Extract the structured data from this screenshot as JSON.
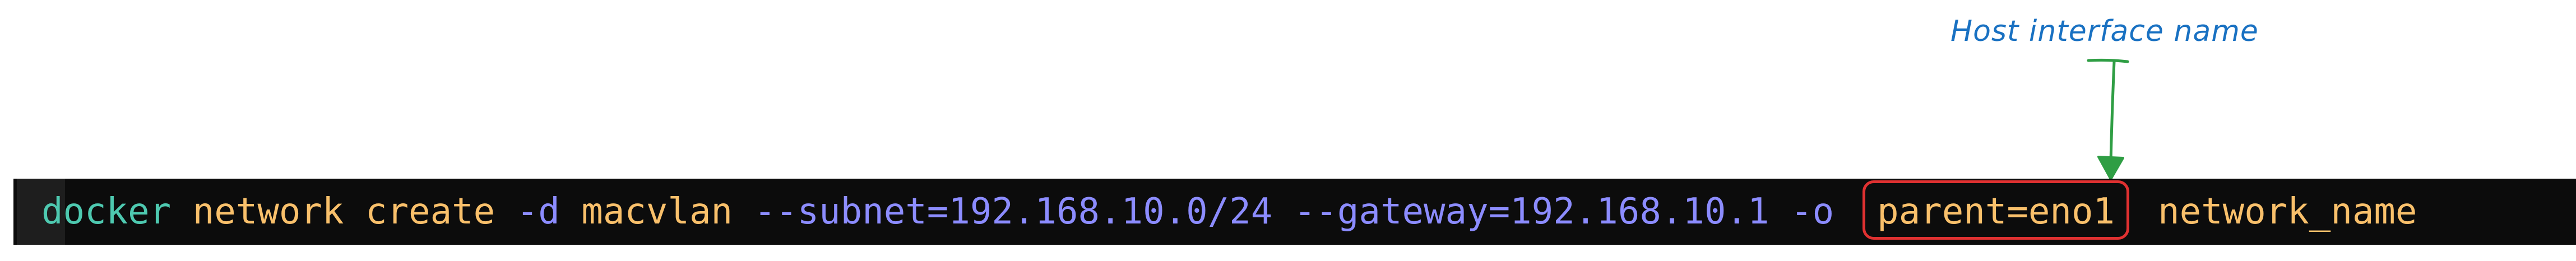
{
  "annotation": {
    "label": "Host interface name",
    "color": "#1971c2",
    "arrow_color": "#2f9e44"
  },
  "command": {
    "tokens": [
      {
        "text": "docker",
        "color": "#4ec9b0"
      },
      {
        "text": " ",
        "color": "#cccccc"
      },
      {
        "text": "network",
        "color": "#f9c06b"
      },
      {
        "text": " ",
        "color": "#cccccc"
      },
      {
        "text": "create",
        "color": "#f9c06b"
      },
      {
        "text": " ",
        "color": "#cccccc"
      },
      {
        "text": "-d",
        "color": "#8c8cff"
      },
      {
        "text": " ",
        "color": "#cccccc"
      },
      {
        "text": "macvlan",
        "color": "#f9c06b"
      },
      {
        "text": " ",
        "color": "#cccccc"
      },
      {
        "text": "--subnet=192.168.10.0/24",
        "color": "#8c8cff"
      },
      {
        "text": " ",
        "color": "#cccccc"
      },
      {
        "text": "--gateway=192.168.10.1",
        "color": "#8c8cff"
      },
      {
        "text": " ",
        "color": "#cccccc"
      },
      {
        "text": "-o",
        "color": "#8c8cff"
      },
      {
        "text": "  ",
        "color": "#cccccc"
      },
      {
        "text": "parent=eno1",
        "color": "#f9c06b"
      },
      {
        "text": "  ",
        "color": "#cccccc"
      },
      {
        "text": "network_name",
        "color": "#f9c06b"
      }
    ]
  },
  "highlight": {
    "color": "#e03131"
  },
  "colors": {
    "terminal_background": "#0c0c0c"
  }
}
